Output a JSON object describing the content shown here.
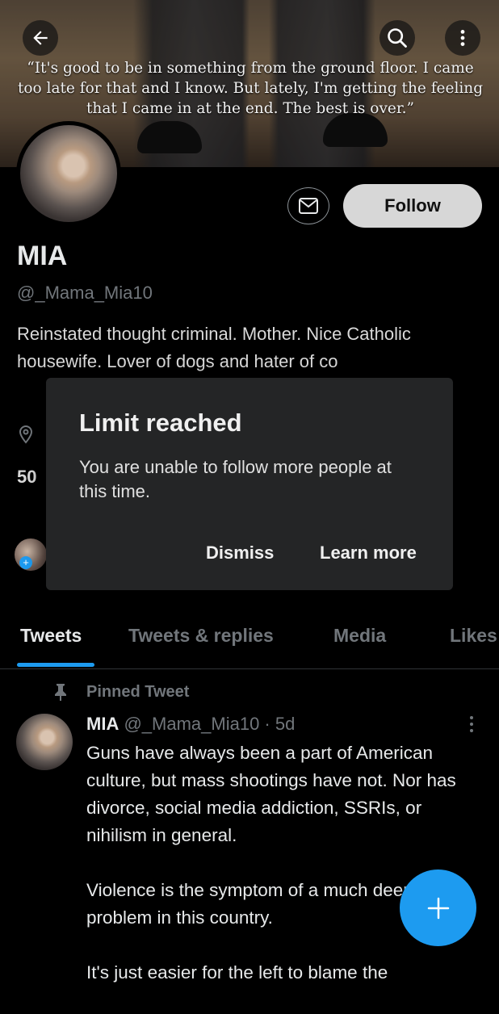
{
  "banner": {
    "quote": "“It's good to be in something from the ground floor. I came too late for that and I know. But lately, I'm getting the feeling that I came in at the end. The best is over.”"
  },
  "header_icons": {
    "back": "arrow-left-icon",
    "search": "search-icon",
    "more": "more-vertical-icon"
  },
  "profile": {
    "name": "MIA",
    "handle": "@_Mama_Mia10",
    "bio": "Reinstated thought criminal. Mother. Nice Catholic housewife. Lover of dogs and hater of co",
    "stats_partial": "50",
    "follow_label": "Follow"
  },
  "dialog": {
    "title": "Limit reached",
    "message": "You are unable to follow more people at this time.",
    "dismiss_label": "Dismiss",
    "learn_more_label": "Learn more"
  },
  "tabs": [
    "Tweets",
    "Tweets & replies",
    "Media",
    "Likes"
  ],
  "pinned_tweet": {
    "pinned_label": "Pinned Tweet",
    "author_name": "MIA",
    "author_meta": "@_Mama_Mia10 · 5d",
    "paragraphs": [
      "Guns have always been a part of American culture, but mass shootings have not. Nor has divorce, social media addiction, SSRIs, or nihilism in general.",
      "Violence is the symptom of a much deeper problem in this country.",
      "It's just easier for the left to blame the"
    ]
  },
  "colors": {
    "accent": "#1d9bf0",
    "background": "#000000",
    "dialog": "#242526"
  }
}
